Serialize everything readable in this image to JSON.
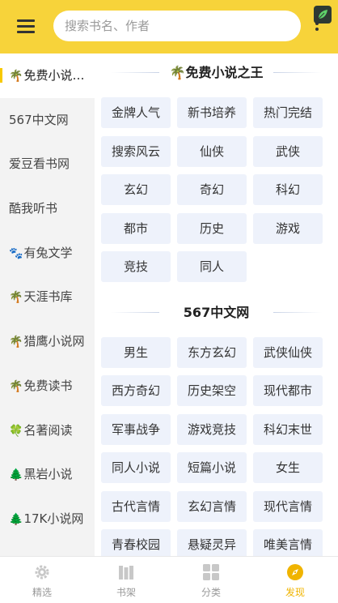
{
  "header": {
    "search_placeholder": "搜索书名、作者"
  },
  "sidebar": {
    "items": [
      {
        "icon": "palm-tree-icon",
        "glyph": "🌴",
        "label": "免费小说…"
      },
      {
        "icon": "",
        "glyph": "",
        "label": "567中文网"
      },
      {
        "icon": "",
        "glyph": "",
        "label": "爱豆看书网"
      },
      {
        "icon": "",
        "glyph": "",
        "label": "酷我听书"
      },
      {
        "icon": "dog-icon",
        "glyph": "🐾",
        "label": "有兔文学"
      },
      {
        "icon": "palm-tree-icon",
        "glyph": "🌴",
        "label": "天涯书库"
      },
      {
        "icon": "palm-tree-icon",
        "glyph": "🌴",
        "label": "猎鹰小说网"
      },
      {
        "icon": "palm-tree-icon",
        "glyph": "🌴",
        "label": "免费读书"
      },
      {
        "icon": "clover-icon",
        "glyph": "🍀",
        "label": "名著阅读"
      },
      {
        "icon": "tree-icon",
        "glyph": "🌲",
        "label": "黑岩小说"
      },
      {
        "icon": "tree-icon",
        "glyph": "🌲",
        "label": "17K小说网"
      }
    ]
  },
  "sections": [
    {
      "icon": "palm-tree-icon",
      "title": "免费小说之王",
      "tags": [
        "金牌人气",
        "新书培养",
        "热门完结",
        "搜索风云",
        "仙侠",
        "武侠",
        "玄幻",
        "奇幻",
        "科幻",
        "都市",
        "历史",
        "游戏",
        "竞技",
        "同人"
      ]
    },
    {
      "icon": "",
      "title": "567中文网",
      "tags": [
        "男生",
        "东方玄幻",
        "武侠仙侠",
        "西方奇幻",
        "历史架空",
        "现代都市",
        "军事战争",
        "游戏竞技",
        "科幻末世",
        "同人小说",
        "短篇小说",
        "女生",
        "古代言情",
        "玄幻言情",
        "现代言情",
        "青春校园",
        "悬疑灵异",
        "唯美言情"
      ]
    }
  ],
  "tabbar": [
    {
      "label": "精选",
      "icon": "gear-icon",
      "active": false
    },
    {
      "label": "书架",
      "icon": "bookshelf-icon",
      "active": false
    },
    {
      "label": "分类",
      "icon": "grid-icon",
      "active": false
    },
    {
      "label": "发现",
      "icon": "compass-icon",
      "active": true
    }
  ],
  "colors": {
    "header": "#f7d33a",
    "accent": "#f0b400",
    "tag_bg": "#eef2fb",
    "sidebar_bg": "#f3f3f3"
  }
}
